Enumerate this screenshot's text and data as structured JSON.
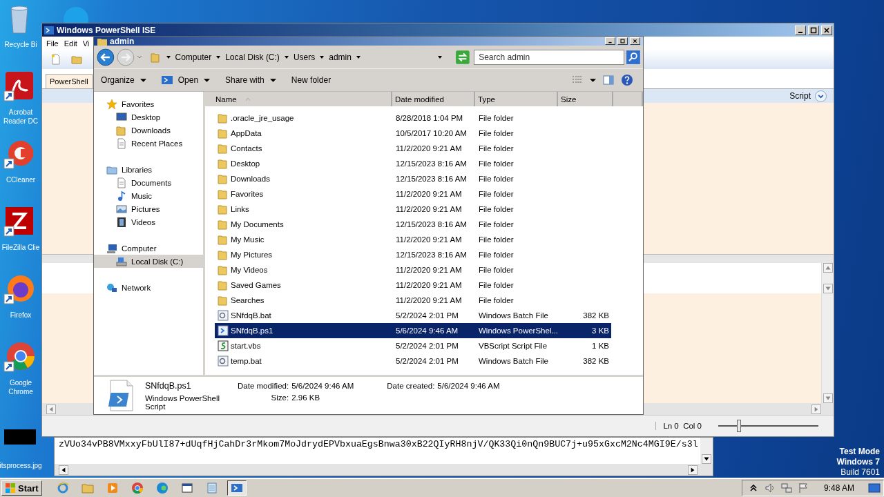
{
  "desktop": {
    "icons": [
      {
        "kind": "recycle",
        "label": "Recycle Bi"
      },
      {
        "kind": "acrobat",
        "label": "Acrobat Reader DC"
      },
      {
        "kind": "ccleaner",
        "label": "CCleaner"
      },
      {
        "kind": "filezilla",
        "label": "FileZilla Clie"
      },
      {
        "kind": "firefox",
        "label": "Firefox"
      },
      {
        "kind": "chrome",
        "label": "Google Chrome"
      },
      {
        "kind": "image",
        "label": "itsprocess.jpg"
      }
    ]
  },
  "ise": {
    "title": "Windows PowerShell ISE",
    "menu": [
      "File",
      "Edit",
      "Vi"
    ],
    "tabs": [
      {
        "label": "PowerShell",
        "selected": true
      }
    ],
    "script_toggle": "Script",
    "status": "Ln 0  Col 0",
    "zoom": {
      "level": 0.21
    }
  },
  "explorer": {
    "title": "admin",
    "path": [
      "Computer",
      "Local Disk (C:)",
      "Users",
      "admin"
    ],
    "search": {
      "placeholder": "Search admin"
    },
    "toolbar": [
      {
        "label": "Organize",
        "kind": "menu"
      },
      {
        "label": "Open",
        "kind": "open"
      },
      {
        "label": "Share with",
        "kind": "menu"
      },
      {
        "label": "New folder",
        "kind": "plain"
      }
    ],
    "nav": [
      {
        "label": "Favorites",
        "kind": "star",
        "selected": false,
        "children": [
          {
            "label": "Desktop",
            "kind": "monitor",
            "selected": false
          },
          {
            "label": "Downloads",
            "kind": "folder",
            "selected": false
          },
          {
            "label": "Recent Places",
            "kind": "doc",
            "selected": false
          }
        ]
      },
      {
        "label": "Libraries",
        "kind": "folder",
        "selected": false,
        "children": [
          {
            "label": "Documents",
            "kind": "doc",
            "selected": false
          },
          {
            "label": "Music",
            "kind": "note",
            "selected": false
          },
          {
            "label": "Pictures",
            "kind": "picture",
            "selected": false
          },
          {
            "label": "Videos",
            "kind": "film",
            "selected": false
          }
        ]
      },
      {
        "label": "Computer",
        "kind": "monitor",
        "selected": false,
        "children": [
          {
            "label": "Local Disk (C:)",
            "kind": "disk",
            "selected": true
          }
        ]
      },
      {
        "label": "Network",
        "kind": "globe",
        "selected": false
      }
    ],
    "columns": [
      "Name",
      "Date modified",
      "Type",
      "Size"
    ],
    "rows": [
      {
        "name": ".oracle_jre_usage",
        "date": "8/28/2018 1:04 PM",
        "type": "File folder",
        "kind": "folder",
        "selected": false
      },
      {
        "name": "AppData",
        "date": "10/5/2017 10:20 AM",
        "type": "File folder",
        "kind": "folder",
        "selected": false
      },
      {
        "name": "Contacts",
        "date": "11/2/2020 9:21 AM",
        "type": "File folder",
        "kind": "folder",
        "selected": false
      },
      {
        "name": "Desktop",
        "date": "12/15/2023 8:16 AM",
        "type": "File folder",
        "kind": "folder",
        "selected": false
      },
      {
        "name": "Downloads",
        "date": "12/15/2023 8:16 AM",
        "type": "File folder",
        "kind": "folder",
        "selected": false
      },
      {
        "name": "Favorites",
        "date": "11/2/2020 9:21 AM",
        "type": "File folder",
        "kind": "folder",
        "selected": false
      },
      {
        "name": "Links",
        "date": "11/2/2020 9:21 AM",
        "type": "File folder",
        "kind": "folder",
        "selected": false
      },
      {
        "name": "My Documents",
        "date": "12/15/2023 8:16 AM",
        "type": "File folder",
        "kind": "folder",
        "selected": false
      },
      {
        "name": "My Music",
        "date": "11/2/2020 9:21 AM",
        "type": "File folder",
        "kind": "folder",
        "selected": false
      },
      {
        "name": "My Pictures",
        "date": "12/15/2023 8:16 AM",
        "type": "File folder",
        "kind": "folder",
        "selected": false
      },
      {
        "name": "My Videos",
        "date": "11/2/2020 9:21 AM",
        "type": "File folder",
        "kind": "folder",
        "selected": false
      },
      {
        "name": "Saved Games",
        "date": "11/2/2020 9:21 AM",
        "type": "File folder",
        "kind": "folder",
        "selected": false
      },
      {
        "name": "Searches",
        "date": "11/2/2020 9:21 AM",
        "type": "File folder",
        "kind": "folder",
        "selected": false
      },
      {
        "name": "SNfdqB.bat",
        "date": "5/2/2024 2:01 PM",
        "type": "Windows Batch File",
        "size": "382 KB",
        "kind": "batch",
        "selected": false
      },
      {
        "name": "SNfdqB.ps1",
        "date": "5/6/2024 9:46 AM",
        "type": "Windows PowerShel...",
        "size": "3 KB",
        "kind": "powershell",
        "selected": true
      },
      {
        "name": "start.vbs",
        "date": "5/2/2024 2:01 PM",
        "type": "VBScript Script File",
        "size": "1 KB",
        "kind": "vbscript",
        "selected": false
      },
      {
        "name": "temp.bat",
        "date": "5/2/2024 2:01 PM",
        "type": "Windows Batch File",
        "size": "382 KB",
        "kind": "batch",
        "selected": false
      }
    ],
    "details": {
      "name": "SNfdqB.ps1",
      "type": "Windows PowerShell Script",
      "fields": [
        {
          "label": "Date modified:",
          "value": "5/6/2024 9:46 AM"
        },
        {
          "label": "Size:",
          "value": "2.96 KB"
        },
        {
          "label": "Date created:",
          "value": "5/6/2024 9:46 AM"
        }
      ]
    }
  },
  "editor": {
    "text": "zVUo34vPB8VMxxyFbUlI87+dUqfHjCahDr3rMkom7MoJdrydEPVbxuaEgsBnwa30xB22QIyRH8njV/QK33Qi0nQn9BUC7j+u95xGxcM2Nc4MGI9E/s3l"
  },
  "taskbar": {
    "start": "Start",
    "apps": [
      {
        "kind": "ie",
        "selected": false
      },
      {
        "kind": "folder",
        "selected": false
      },
      {
        "kind": "media",
        "selected": false
      },
      {
        "kind": "chrome",
        "selected": false
      },
      {
        "kind": "edge",
        "selected": false
      },
      {
        "kind": "app",
        "selected": false
      },
      {
        "kind": "notepad",
        "selected": false
      },
      {
        "kind": "powershell",
        "selected": true
      }
    ],
    "clock": "9:48 AM"
  },
  "os_notice": [
    "Test Mode",
    "Windows 7",
    "Build 7601"
  ]
}
